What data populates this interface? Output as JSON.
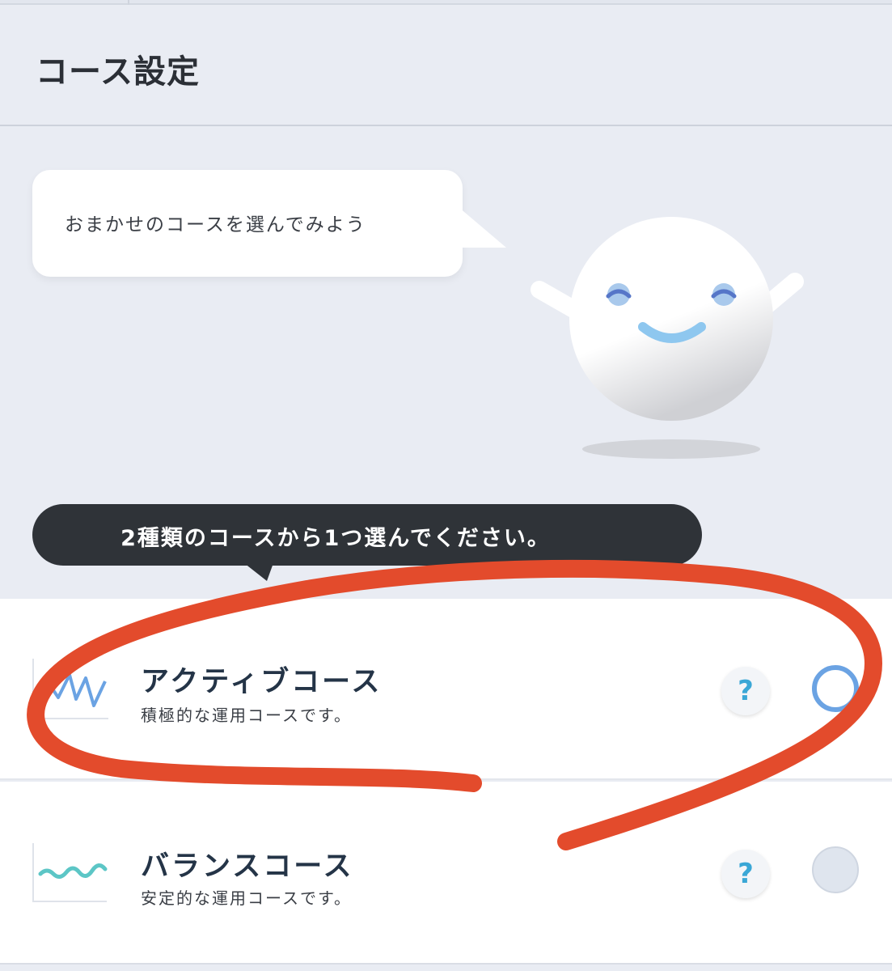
{
  "header": {
    "title": "コース設定"
  },
  "assistant": {
    "bubble_text": "おまかせのコースを選んでみよう"
  },
  "hint": {
    "text": "2種類のコースから1つ選んでください。"
  },
  "courses": [
    {
      "name": "アクティブコース",
      "description": "積極的な運用コースです。",
      "help_label": "?",
      "selected": true,
      "icon": "zigzag-chart-icon",
      "color": "#6ba3e3"
    },
    {
      "name": "バランスコース",
      "description": "安定的な運用コースです。",
      "help_label": "?",
      "selected": false,
      "icon": "wave-chart-icon",
      "color": "#5cc6c6"
    }
  ],
  "colors": {
    "background": "#e9ecf3",
    "hint_bg": "#2f3338",
    "help_text": "#3aa7d6",
    "annotation": "#e34b2c"
  }
}
